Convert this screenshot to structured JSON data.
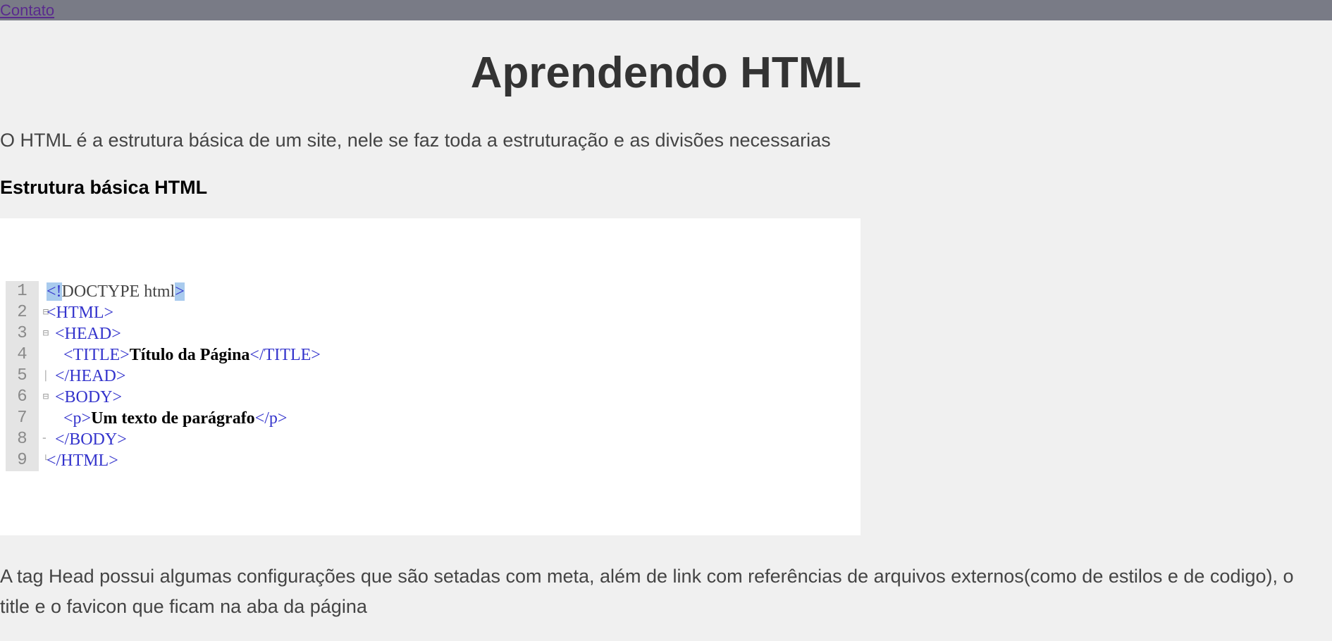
{
  "nav": {
    "contact_label": "Contato"
  },
  "page": {
    "title": "Aprendendo HTML",
    "intro": "O HTML é a estrutura básica de um site, nele se faz toda a estruturação e as divisões necessarias",
    "section_title": "Estrutura básica HTML",
    "head_paragraph": "A tag Head possui algumas configurações que são setadas com meta, além de link com referências de arquivos externos(como de estilos e de codigo), o title e o favicon que ficam na aba da página"
  },
  "code_example": {
    "line_numbers": [
      "1",
      "2",
      "3",
      "4",
      "5",
      "6",
      "7",
      "8",
      "9"
    ],
    "lines": [
      {
        "indent": "",
        "parts": [
          {
            "t": "<!",
            "c": "hl"
          },
          {
            "t": "DOCTYPE html",
            "c": "plain"
          },
          {
            "t": ">",
            "c": "hl"
          }
        ]
      },
      {
        "indent": "",
        "parts": [
          {
            "t": "<HTML>",
            "c": "tag"
          }
        ]
      },
      {
        "indent": "  ",
        "parts": [
          {
            "t": "<HEAD>",
            "c": "tag"
          }
        ]
      },
      {
        "indent": "    ",
        "parts": [
          {
            "t": "<TITLE>",
            "c": "tag"
          },
          {
            "t": "Título da Página",
            "c": "txt"
          },
          {
            "t": "</TITLE>",
            "c": "tag"
          }
        ]
      },
      {
        "indent": "  ",
        "parts": [
          {
            "t": "</HEAD>",
            "c": "tag"
          }
        ]
      },
      {
        "indent": "  ",
        "parts": [
          {
            "t": "<BODY>",
            "c": "tag"
          }
        ]
      },
      {
        "indent": "    ",
        "parts": [
          {
            "t": "<p>",
            "c": "tag"
          },
          {
            "t": "Um texto de parágrafo",
            "c": "txt"
          },
          {
            "t": "</p>",
            "c": "tag"
          }
        ]
      },
      {
        "indent": "  ",
        "parts": [
          {
            "t": "</BODY>",
            "c": "tag"
          }
        ]
      },
      {
        "indent": "",
        "parts": [
          {
            "t": "</HTML>",
            "c": "tag"
          }
        ]
      }
    ],
    "fold_markers": [
      "",
      "⊟",
      "⊟",
      "",
      "│",
      "⊟",
      "",
      "╴",
      "└"
    ]
  },
  "colors": {
    "topbar": "#797b86",
    "background": "#f0f0f0",
    "link": "#5a2a8e",
    "code_tag": "#3333cc",
    "code_highlight": "#a9cbee"
  }
}
